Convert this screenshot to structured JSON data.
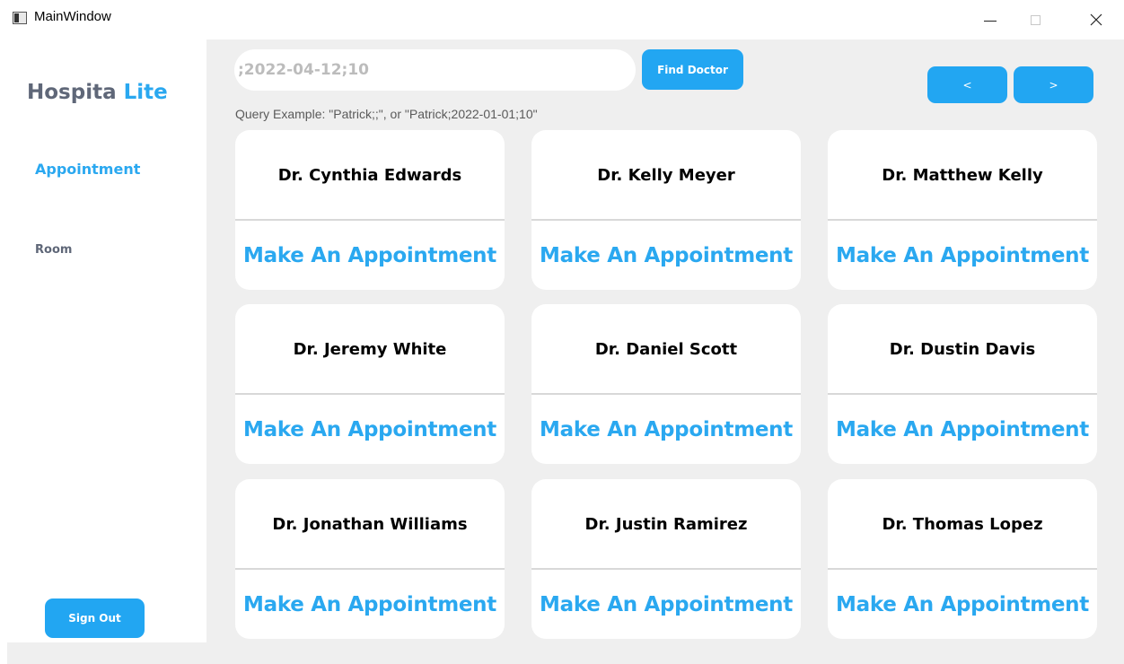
{
  "window": {
    "title": "MainWindow",
    "controls": {
      "minimize": "minimize-icon",
      "maximize": "maximize-icon",
      "close": "close-icon"
    }
  },
  "sidebar": {
    "brand_part1": "Hospita",
    "brand_part2": "Lite",
    "nav": [
      {
        "label": "Appointment",
        "active": true
      },
      {
        "label": "Room",
        "active": false
      }
    ],
    "sign_out_label": "Sign Out"
  },
  "search": {
    "value": ";2022-04-12;10",
    "button_label": "Find Doctor",
    "hint": "Query Example: \"Patrick;;\", or \"Patrick;2022-01-01;10\""
  },
  "pagination": {
    "prev_label": "<",
    "next_label": ">"
  },
  "doctors": [
    {
      "name": "Dr. Cynthia Edwards",
      "action": "Make An Appointment"
    },
    {
      "name": "Dr. Kelly Meyer",
      "action": "Make An Appointment"
    },
    {
      "name": "Dr. Matthew Kelly",
      "action": "Make An Appointment"
    },
    {
      "name": "Dr. Jeremy White",
      "action": "Make An Appointment"
    },
    {
      "name": "Dr. Daniel Scott",
      "action": "Make An Appointment"
    },
    {
      "name": "Dr. Dustin Davis",
      "action": "Make An Appointment"
    },
    {
      "name": "Dr. Jonathan Williams",
      "action": "Make An Appointment"
    },
    {
      "name": "Dr. Justin Ramirez",
      "action": "Make An Appointment"
    },
    {
      "name": "Dr. Thomas Lopez",
      "action": "Make An Appointment"
    }
  ],
  "colors": {
    "accent": "#22a6f2",
    "brand_gray": "#5f6778",
    "main_background": "#efefef"
  }
}
